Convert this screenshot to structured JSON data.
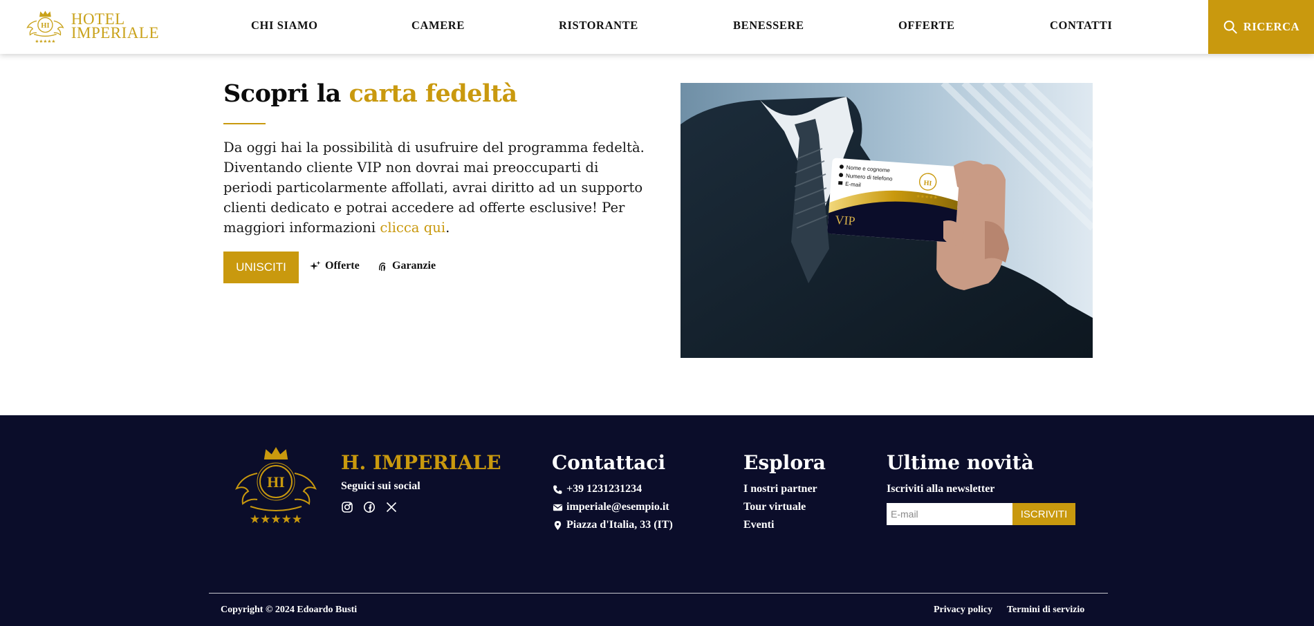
{
  "brand": {
    "line1": "HOTEL",
    "line2": "IMPERIALE",
    "emblem_initials": "HI",
    "emblem_stars": "★★★★★"
  },
  "nav": {
    "items": [
      "CHI SIAMO",
      "CAMERE",
      "RISTORANTE",
      "BENESSERE",
      "OFFERTE",
      "CONTATTI"
    ],
    "search_label": "RICERCA",
    "search_icon": "search-icon"
  },
  "hero": {
    "title_plain": "Scopri la ",
    "title_accent": "carta fedeltà",
    "body": "Da oggi hai la possibilità di usufruire del programma fedeltà. Diventando cliente VIP non dovrai mai preoccuparti di periodi particolarmente affollati, avrai diritto ad un supporto clienti dedicato e potrai accedere ad offerte esclusive! Per maggiori informazioni ",
    "link": "clicca qui",
    "body_end": ".",
    "join_button": "UNISCITI",
    "offers_link": "Offerte",
    "guarantees_link": "Garanzie",
    "card": {
      "field1": "Nome e cognome",
      "field2": "Numero di telefono",
      "field3": "E-mail",
      "vip": "VIP",
      "initials": "HI",
      "stars": "★★★★★"
    }
  },
  "footer": {
    "brand": "H. IMPERIALE",
    "emblem_initials": "HI",
    "emblem_stars": "★★★★★",
    "social_label": "Seguici sui social",
    "social_icons": [
      "instagram-icon",
      "facebook-icon",
      "x-icon"
    ],
    "contact": {
      "title": "Contattaci",
      "phone": "+39 1231231234",
      "email": "imperiale@esempio.it",
      "address": "Piazza d'Italia, 33 (IT)"
    },
    "explore": {
      "title": "Esplora",
      "links": [
        "I nostri partner",
        "Tour virtuale",
        "Eventi"
      ]
    },
    "news": {
      "title": "Ultime novità",
      "subtitle": "Iscriviti alla newsletter",
      "placeholder": "E-mail",
      "button": "ISCRIVITI"
    },
    "copyright": "Copyright © 2024 Edoardo Busti",
    "privacy": "Privacy policy",
    "terms": "Termini di servizio"
  },
  "colors": {
    "gold": "#c9990e",
    "navy": "#0b0d2a",
    "white": "#ffffff"
  }
}
